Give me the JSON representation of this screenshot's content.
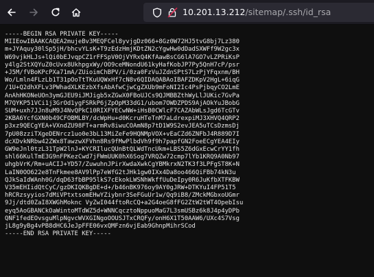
{
  "browser": {
    "url_host": "10.201.13.212",
    "url_path": "/sitemap/.ssh/id_rsa",
    "icons": [
      "back-arrow-icon",
      "forward-arrow-icon",
      "reload-icon",
      "home-icon",
      "shield-icon",
      "insecure-lock-icon"
    ]
  },
  "document": {
    "lines": [
      "-----BEGIN RSA PRIVATE KEY-----",
      "MIIEowIBAAKCAQEA2mujeBv3MEQFCel8yvjgDz066+8Gz0W72HJ5tvG8bj7Lz380",
      "m+JYAquy30lSp5jH/bhcvYLsK+T9zEdzHmjKDtZN2cYgwHw0dDadSXWFf9W2gc3x",
      "W69vjkHLJs+lQi0bEJvqpCZ1rFFSpV0OjVYRxQ4KfAawBsCG6lA7GO7vLZPRiKsP",
      "y4lg2StXQYuZ0cUvx8UkhpgxWy/OO9ceMNondU61kyHafKobJP7Py5QnH7cP/psr",
      "+J5M/fVBoKPcPXa71mA/ZUioimChBPV/i/0za0FzVuJZdnSPtS7LzPjYFqxnm/BH",
      "Wo/Lmln4FLzLb1T31pOoTtTKuUQWxHf7cN8v6QIDAQABAoIBAFZDKpV2HgL+6iqG",
      "/1U+Q2dhXFLv3PWhadXLKEzbXfsAbAfwCjwCgZXUb9mFoNI2Ic4PsPjbqyCO2LmE",
      "AnAhHKONeUOn3ymGJEU9iJMJigb5xZGwX0FBoUJCs9QJMBBZthWyLlJUKic7GvPa",
      "M7QYKP51VCi1j3GrOd1ygFSRkP6jZpOpM33dG1/ubom7OWDZPDS9AjAOkYuJBobG",
      "SUM+uxh7JJn8uM9J4NvQPkC10RIXFYECwNW+iHsB0CWlcF7CAZAbWLsJgd6TcGTv",
      "2KBA6YcfGXN0b49CFOBMLBY/dcWpHu+d0KcruHTeTnM7aLdrexpiMJ3XHVQ4QRP2",
      "p3xz9QECgYEA+VXndZU98FT+armRv8iwuCOAmN8p7tD1W9S2evJEA5uTCsDzmsDj",
      "7pU08zziTXgeDENrcz1uo0e3bL13MiZeFe9HQNMpVOX+vEaCZd6ZNFbJ4R889D7I",
      "dcXDvkNRbw42ZWx8TawzwXFVhn8Rs9fMwPlbdVh9f9h7papfGN2FoeECgYEA4EIy",
      "GW9eJnl0tzL31TpW2lnJ+KYCRIlucQUnBtQLWdTncUkm+LBS5Z6dGxEcwCrYY1fh",
      "shl66KulTmE3G9nFPKezCwd7jFWmUUK0hX6Sog7VRQZw72cmp7lYb1KRQ9A0Nb97",
      "uhgbVrK/Rm+uACIJ+YD57/ZuwuhnJPirXwdaXwkCgYBMkrxN2TK3f3LPFgST8K+N",
      "LaIN0OO622e8TnFkmee8AV9lPp7eWfG2tJHk1gw0IXx4Da8oo466QiFBb74kN3u",
      "QJkSaIdWAnh0G/dqD63fbBP95lkS7cEkokLWSNhWkffUuDeIpy0R6JuKfbXTFKBW",
      "V35mEHIidQtCyC/gzDKIQKBgDE+d+/b46nBK976oy9AY0gJRW+DTKYuI4FP51T5",
      "hRCRzsyyios7dMiVPtxtsomEHwYZiybnr3SeFGuUr1w/Qq9iB8/ZMckMGbxoUGmr",
      "9Jj/dtd0ZaI8XWGhMoknc VyZwI044ftoRcCQ+a2G4oeG8fFG2ZtW2tWT4OpebIsu",
      "eyq5AoGBANCkOaWintoMTdWZ5d+WNNCqcztoNppuoMaG7L3smUSBz6k8J4p4yDPb",
      "QNF1fedEOvsguMlpNgvcWVXGINgoOOUSJTxCRQFy/onH6X1T50AAW6/UXc4S7Vsg",
      "jL8g9yBg4vPB8dHC6JeJpFFE06vxQMFzn6vjEab9GhnpMihrSCod",
      "-----END RSA PRIVATE KEY-----"
    ]
  },
  "colors": {
    "toolbar_bg": "#1c1b22",
    "urlbar_bg": "#2b2a33",
    "page_bg": "#0f0f0f",
    "text": "#e8e8e8"
  }
}
